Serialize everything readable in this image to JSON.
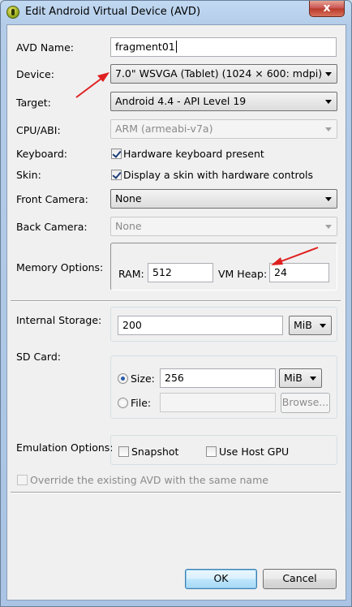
{
  "window": {
    "title": "Edit Android Virtual Device (AVD)",
    "close_glyph": "x"
  },
  "form": {
    "avd_name": {
      "label": "AVD Name:",
      "value": "fragment01"
    },
    "device": {
      "label": "Device:",
      "value": "7.0\" WSVGA (Tablet) (1024 × 600: mdpi)"
    },
    "target": {
      "label": "Target:",
      "value": "Android 4.4 - API Level 19"
    },
    "cpu_abi": {
      "label": "CPU/ABI:",
      "value": "ARM (armeabi-v7a)"
    },
    "keyboard": {
      "label": "Keyboard:",
      "checkbox_label": "Hardware keyboard present",
      "checked": true
    },
    "skin": {
      "label": "Skin:",
      "checkbox_label": "Display a skin with hardware controls",
      "checked": true
    },
    "front_camera": {
      "label": "Front Camera:",
      "value": "None"
    },
    "back_camera": {
      "label": "Back Camera:",
      "value": "None"
    },
    "memory": {
      "label": "Memory Options:",
      "ram_label": "RAM:",
      "ram_value": "512",
      "vm_heap_label": "VM Heap:",
      "vm_heap_value": "24"
    },
    "internal_storage": {
      "label": "Internal Storage:",
      "value": "200",
      "unit": "MiB"
    },
    "sd_card": {
      "label": "SD Card:",
      "size_label": "Size:",
      "size_value": "256",
      "size_unit": "MiB",
      "size_selected": true,
      "file_label": "File:",
      "file_value": "",
      "browse_label": "Browse..."
    },
    "emulation": {
      "label": "Emulation Options:",
      "snapshot_label": "Snapshot",
      "host_gpu_label": "Use Host GPU"
    },
    "override": {
      "label": "Override the existing AVD with the same name",
      "enabled": false
    }
  },
  "buttons": {
    "ok": "OK",
    "cancel": "Cancel"
  },
  "colors": {
    "annotation_arrow": "#e02020",
    "titlebar": "#b3cce8",
    "content_bg": "#f0f0f0"
  }
}
